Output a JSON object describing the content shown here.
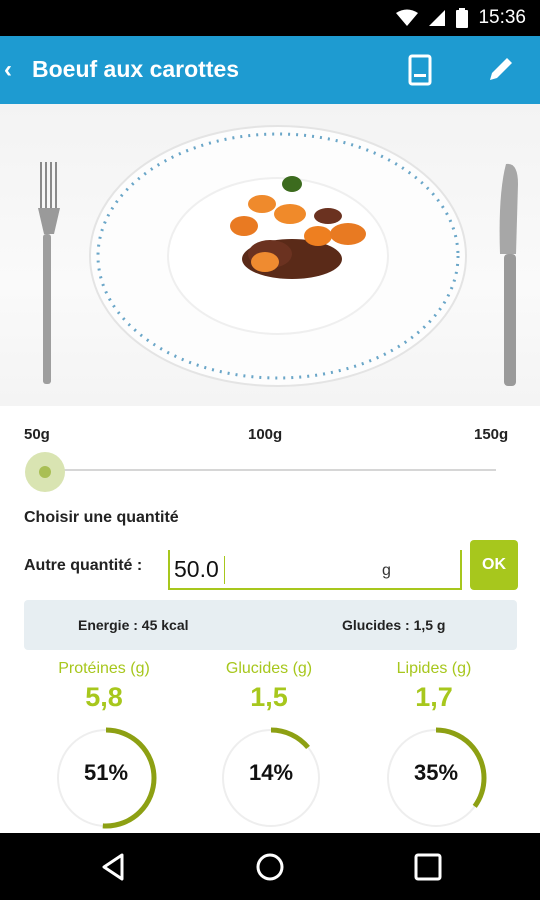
{
  "status_bar": {
    "time": "15:36"
  },
  "app_bar": {
    "back": "‹",
    "title": "Boeuf aux carottes"
  },
  "slider": {
    "labels": [
      "50g",
      "100g",
      "150g"
    ],
    "value_grams": 50
  },
  "quantity": {
    "choose_label": "Choisir une quantité",
    "other_label": "Autre quantité :",
    "value": "50.0",
    "unit": "g",
    "ok_label": "OK"
  },
  "summary": {
    "energy": "Energie : 45 kcal",
    "carbs": "Glucides : 1,5 g"
  },
  "macros": [
    {
      "name": "Protéines (g)",
      "value": "5,8",
      "percent_label": "51%",
      "percent": 51
    },
    {
      "name": "Glucides (g)",
      "value": "1,5",
      "percent_label": "14%",
      "percent": 14
    },
    {
      "name": "Lipides (g)",
      "value": "1,7",
      "percent_label": "35%",
      "percent": 35
    }
  ],
  "colors": {
    "app_bar": "#1e9bd1",
    "accent": "#a7c71d",
    "ring_track": "#eeeeee"
  }
}
